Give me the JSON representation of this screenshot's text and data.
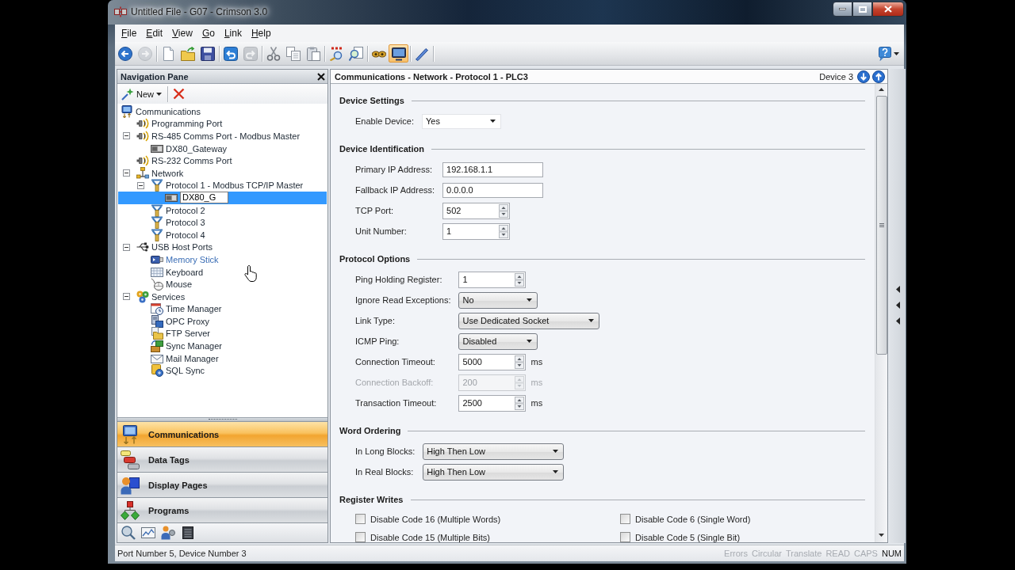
{
  "window": {
    "title": "Untitled File - G07 - Crimson 3.0"
  },
  "menu": [
    "File",
    "Edit",
    "View",
    "Go",
    "Link",
    "Help"
  ],
  "toolbar": [
    [
      {
        "kind": "back",
        "disabled": false,
        "pressed": false
      },
      {
        "kind": "forward",
        "disabled": true,
        "pressed": false
      }
    ],
    [
      {
        "kind": "new",
        "disabled": false,
        "pressed": false
      },
      {
        "kind": "open",
        "disabled": false,
        "pressed": false
      },
      {
        "kind": "save",
        "disabled": false,
        "pressed": false
      }
    ],
    [
      {
        "kind": "undo",
        "disabled": false,
        "pressed": false
      },
      {
        "kind": "redo",
        "disabled": true,
        "pressed": false
      }
    ],
    [
      {
        "kind": "cut",
        "disabled": false,
        "pressed": false
      },
      {
        "kind": "copy",
        "disabled": false,
        "pressed": false
      },
      {
        "kind": "paste",
        "disabled": false,
        "pressed": false
      }
    ],
    [
      {
        "kind": "findall",
        "disabled": false,
        "pressed": false
      },
      {
        "kind": "find",
        "disabled": false,
        "pressed": false
      }
    ],
    [
      {
        "kind": "watch",
        "disabled": false,
        "pressed": false
      },
      {
        "kind": "monitor",
        "disabled": false,
        "pressed": true
      }
    ],
    [
      {
        "kind": "pen",
        "disabled": false,
        "pressed": false
      }
    ]
  ],
  "navigation_pane": {
    "title": "Navigation Pane",
    "new_button": "New",
    "tree": [
      {
        "label": "Communications",
        "kind": "computer",
        "selected": false,
        "hovered": false,
        "children": [
          {
            "label": "Programming Port",
            "kind": "port",
            "selected": false,
            "hovered": false
          },
          {
            "label": "RS-485 Comms Port - Modbus Master",
            "kind": "port",
            "selected": false,
            "hovered": false,
            "expanded": true,
            "children": [
              {
                "label": "DX80_Gateway",
                "kind": "module",
                "selected": false,
                "hovered": false
              }
            ]
          },
          {
            "label": "RS-232 Comms Port",
            "kind": "port",
            "selected": false,
            "hovered": false
          },
          {
            "label": "Network",
            "kind": "network",
            "selected": false,
            "hovered": false,
            "expanded": true,
            "children": [
              {
                "label": "Protocol 1 - Modbus TCP/IP Master",
                "kind": "protocol",
                "selected": false,
                "hovered": false,
                "expanded": true,
                "children": [
                  {
                    "label": "DX80_G",
                    "kind": "module",
                    "selected": true,
                    "hovered": false
                  }
                ]
              },
              {
                "label": "Protocol 2",
                "kind": "protocol",
                "selected": false,
                "hovered": false
              },
              {
                "label": "Protocol 3",
                "kind": "protocol",
                "selected": false,
                "hovered": false
              },
              {
                "label": "Protocol 4",
                "kind": "protocol",
                "selected": false,
                "hovered": false
              }
            ]
          },
          {
            "label": "USB Host Ports",
            "kind": "usb",
            "selected": false,
            "hovered": false,
            "expanded": true,
            "children": [
              {
                "label": "Memory Stick",
                "kind": "memory",
                "selected": false,
                "hovered": true
              },
              {
                "label": "Keyboard",
                "kind": "keyboard",
                "selected": false,
                "hovered": false
              },
              {
                "label": "Mouse",
                "kind": "mouse",
                "selected": false,
                "hovered": false
              }
            ]
          },
          {
            "label": "Services",
            "kind": "services",
            "selected": false,
            "hovered": false,
            "expanded": true,
            "children": [
              {
                "label": "Time Manager",
                "kind": "clock",
                "selected": false,
                "hovered": false
              },
              {
                "label": "OPC Proxy",
                "kind": "opc",
                "selected": false,
                "hovered": false
              },
              {
                "label": "FTP Server",
                "kind": "folder",
                "selected": false,
                "hovered": false
              },
              {
                "label": "Sync Manager",
                "kind": "sync",
                "selected": false,
                "hovered": false
              },
              {
                "label": "Mail Manager",
                "kind": "mail",
                "selected": false,
                "hovered": false
              },
              {
                "label": "SQL Sync",
                "kind": "database",
                "selected": false,
                "hovered": false
              }
            ]
          }
        ]
      }
    ],
    "categories": [
      {
        "label": "Communications",
        "kind": "comms",
        "selected": true
      },
      {
        "label": "Data Tags",
        "kind": "tags",
        "selected": false
      },
      {
        "label": "Display Pages",
        "kind": "pages",
        "selected": false
      },
      {
        "label": "Programs",
        "kind": "programs",
        "selected": false
      }
    ]
  },
  "editor": {
    "breadcrumb": "Communications - Network - Protocol 1 - PLC3",
    "device": "Device 3",
    "sections": [
      {
        "title": "Device Settings",
        "fields": [
          {
            "label": "Enable Device:",
            "kind": "combo",
            "value": "Yes",
            "disabled": false
          }
        ]
      },
      {
        "title": "Device Identification",
        "fields": [
          {
            "label": "Primary IP Address:",
            "kind": "text",
            "value": "192.168.1.1",
            "disabled": false
          },
          {
            "label": "Fallback IP Address:",
            "kind": "text",
            "value": "0.0.0.0",
            "disabled": false
          },
          {
            "label": "TCP Port:",
            "kind": "spin",
            "value": "502",
            "disabled": false
          },
          {
            "label": "Unit Number:",
            "kind": "spin",
            "value": "1",
            "disabled": false
          }
        ]
      },
      {
        "title": "Protocol Options",
        "fields": [
          {
            "label": "Ping Holding Register:",
            "kind": "spin",
            "value": "1",
            "disabled": false
          },
          {
            "label": "Ignore Read Exceptions:",
            "kind": "dropdown",
            "value": "No",
            "disabled": false
          },
          {
            "label": "Link Type:",
            "kind": "dropdown",
            "value": "Use Dedicated Socket",
            "disabled": false
          },
          {
            "label": "ICMP Ping:",
            "kind": "dropdown",
            "value": "Disabled",
            "disabled": false
          },
          {
            "label": "Connection Timeout:",
            "kind": "spin",
            "value": "5000",
            "unit": "ms",
            "disabled": false
          },
          {
            "label": "Connection Backoff:",
            "kind": "spin",
            "value": "200",
            "unit": "ms",
            "disabled": true
          },
          {
            "label": "Transaction Timeout:",
            "kind": "spin",
            "value": "2500",
            "unit": "ms",
            "disabled": false
          }
        ]
      },
      {
        "title": "Word Ordering",
        "fields": [
          {
            "label": "In Long Blocks:",
            "kind": "dropdown",
            "value": "High Then Low",
            "disabled": false
          },
          {
            "label": "In Real Blocks:",
            "kind": "dropdown",
            "value": "High Then Low",
            "disabled": false
          }
        ]
      },
      {
        "title": "Register Writes",
        "checkboxes": [
          {
            "label": "Disable Code 16 (Multiple Words)",
            "checked": false
          },
          {
            "label": "Disable Code 6 (Single Word)",
            "checked": false
          },
          {
            "label": "Disable Code 15 (Multiple Bits)",
            "checked": false
          },
          {
            "label": "Disable Code 5 (Single Bit)",
            "checked": false
          }
        ]
      }
    ]
  },
  "status_bar": {
    "text": "Port Number 5, Device Number 3",
    "indicators": [
      {
        "label": "Errors",
        "on": false
      },
      {
        "label": "Circular",
        "on": false
      },
      {
        "label": "Translate",
        "on": false
      },
      {
        "label": "READ",
        "on": false
      },
      {
        "label": "CAPS",
        "on": false
      },
      {
        "label": "NUM",
        "on": true
      }
    ]
  }
}
